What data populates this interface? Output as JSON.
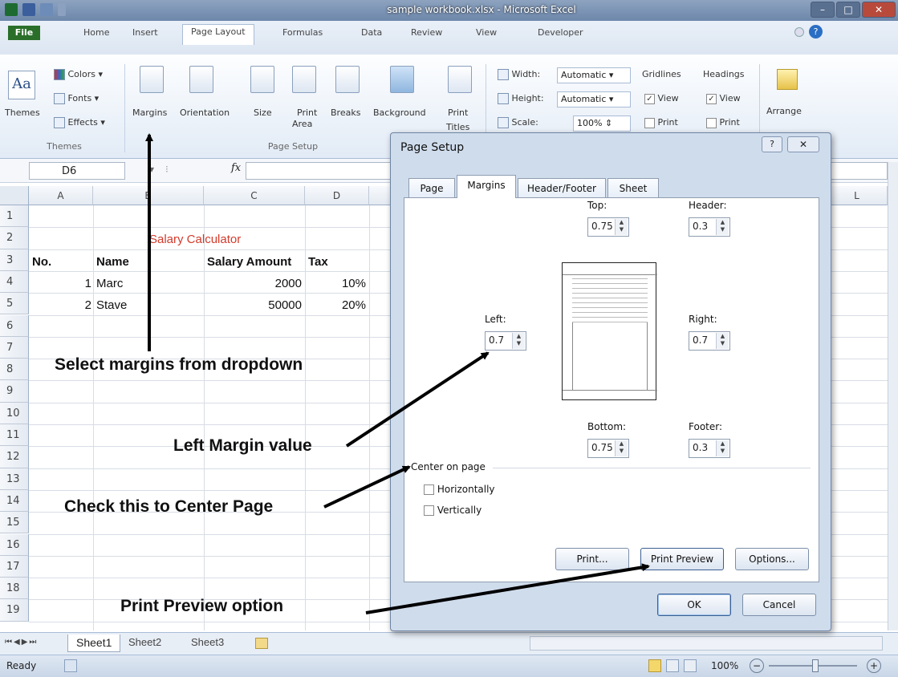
{
  "window": {
    "title": "sample workbook.xlsx - Microsoft Excel"
  },
  "tabs": [
    "File",
    "Home",
    "Insert",
    "Page Layout",
    "Formulas",
    "Data",
    "Review",
    "View",
    "Developer"
  ],
  "ribbon": {
    "themes": {
      "big": "Themes",
      "colors": "Colors",
      "fonts": "Fonts",
      "effects": "Effects",
      "group": "Themes"
    },
    "page_setup": {
      "margins": "Margins",
      "orientation": "Orientation",
      "size": "Size",
      "print_area_1": "Print",
      "print_area_2": "Area",
      "breaks": "Breaks",
      "background": "Background",
      "print_titles_1": "Print",
      "print_titles_2": "Titles",
      "group": "Page Setup"
    },
    "scale": {
      "width_label": "Width:",
      "width_value": "Automatic",
      "height_label": "Height:",
      "height_value": "Automatic",
      "scale_label": "Scale:",
      "scale_value": "100%"
    },
    "sheet_options": {
      "gridlines": "Gridlines",
      "headings": "Headings",
      "view": "View",
      "print": "Print"
    },
    "arrange": "Arrange"
  },
  "formula_bar": {
    "name_box": "D6",
    "fx": "fx"
  },
  "columns": [
    "A",
    "B",
    "C",
    "D",
    "L"
  ],
  "rows": [
    "1",
    "2",
    "3",
    "4",
    "5",
    "6",
    "7",
    "8",
    "9",
    "10",
    "11",
    "12",
    "13",
    "14",
    "15",
    "16",
    "17",
    "18",
    "19"
  ],
  "sheet": {
    "title": "Salary Calculator",
    "headers": [
      "No.",
      "Name",
      "Salary Amount",
      "Tax"
    ],
    "data": [
      {
        "no": "1",
        "name": "Marc",
        "amount": "2000",
        "tax": "10%"
      },
      {
        "no": "2",
        "name": "Stave",
        "amount": "50000",
        "tax": "20%"
      }
    ]
  },
  "sheet_tabs": [
    "Sheet1",
    "Sheet2",
    "Sheet3"
  ],
  "status": {
    "ready": "Ready",
    "zoom": "100%"
  },
  "dialog": {
    "title": "Page Setup",
    "tabs": [
      "Page",
      "Margins",
      "Header/Footer",
      "Sheet"
    ],
    "top_label": "Top:",
    "top": "0.75",
    "header_label": "Header:",
    "header": "0.3",
    "left_label": "Left:",
    "left": "0.7",
    "right_label": "Right:",
    "right": "0.7",
    "bottom_label": "Bottom:",
    "bottom": "0.75",
    "footer_label": "Footer:",
    "footer": "0.3",
    "center_label": "Center on page",
    "horizontally": "Horizontally",
    "vertically": "Vertically",
    "print_btn": "Print...",
    "preview_btn": "Print Preview",
    "options_btn": "Options...",
    "ok": "OK",
    "cancel": "Cancel"
  },
  "annotations": {
    "margins": "Select margins from dropdown",
    "left": "Left Margin value",
    "center": "Check this to Center Page",
    "preview": "Print Preview option"
  }
}
